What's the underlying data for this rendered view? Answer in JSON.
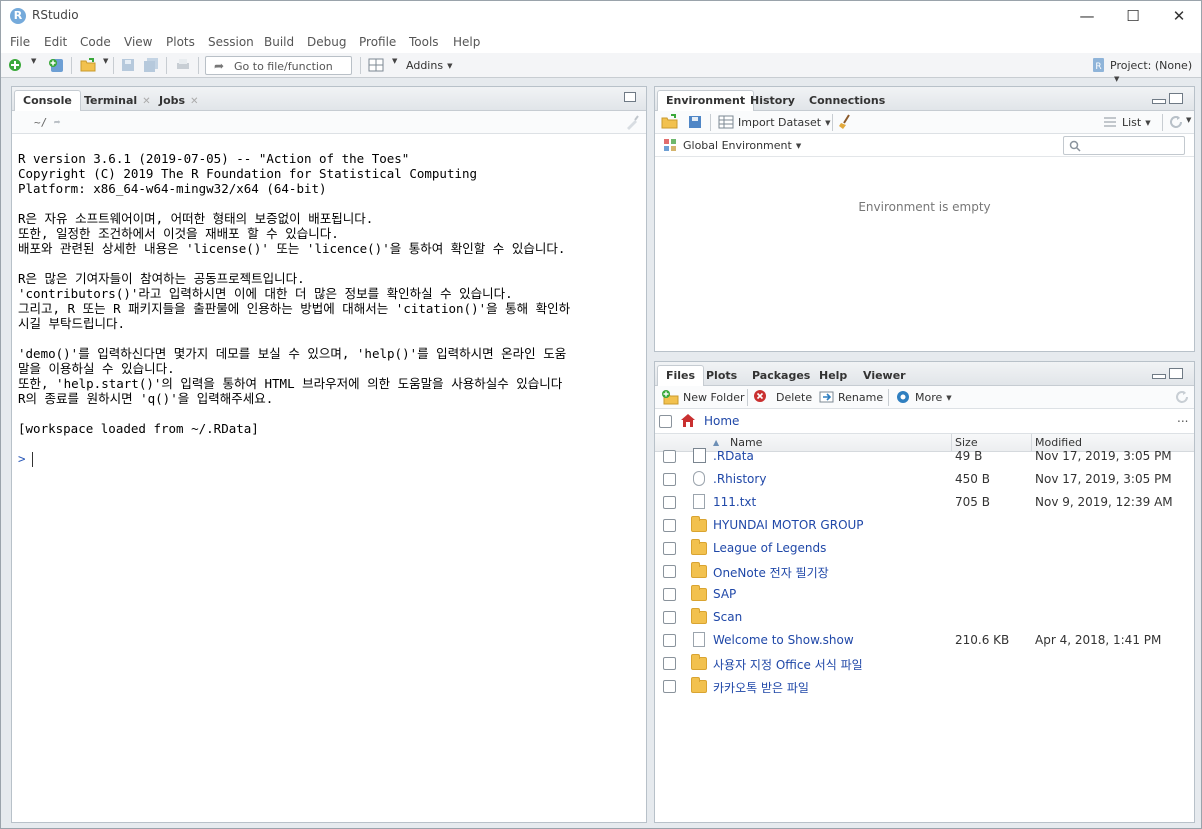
{
  "app": {
    "title": "RStudio",
    "icon_letter": "R"
  },
  "window_controls": {
    "minimize": "—",
    "maximize": "☐",
    "close": "✕"
  },
  "menubar": [
    "File",
    "Edit",
    "Code",
    "View",
    "Plots",
    "Session",
    "Build",
    "Debug",
    "Profile",
    "Tools",
    "Help"
  ],
  "toolbar": {
    "goto_placeholder": "Go to file/function",
    "addins_label": "Addins",
    "project_label": "Project: (None)"
  },
  "console_pane": {
    "tabs": [
      {
        "label": "Console",
        "active": true,
        "closable": false
      },
      {
        "label": "Terminal",
        "active": false,
        "closable": true
      },
      {
        "label": "Jobs",
        "active": false,
        "closable": true
      }
    ],
    "path": "~/",
    "lines": [
      "R version 3.6.1 (2019-07-05) -- \"Action of the Toes\"",
      "Copyright (C) 2019 The R Foundation for Statistical Computing",
      "Platform: x86_64-w64-mingw32/x64 (64-bit)",
      "",
      "R은 자유 소프트웨어이며, 어떠한 형태의 보증없이 배포됩니다.",
      "또한, 일정한 조건하에서 이것을 재배포 할 수 있습니다.",
      "배포와 관련된 상세한 내용은 'license()' 또는 'licence()'을 통하여 확인할 수 있습니다.",
      "",
      "R은 많은 기여자들이 참여하는 공동프로젝트입니다.",
      "'contributors()'라고 입력하시면 이에 대한 더 많은 정보를 확인하실 수 있습니다.",
      "그리고, R 또는 R 패키지들을 출판물에 인용하는 방법에 대해서는 'citation()'을 통해 확인하",
      "시길 부탁드립니다.",
      "",
      "'demo()'를 입력하신다면 몇가지 데모를 보실 수 있으며, 'help()'를 입력하시면 온라인 도움",
      "말을 이용하실 수 있습니다.",
      "또한, 'help.start()'의 입력을 통하여 HTML 브라우저에 의한 도움말을 사용하실수 있습니다",
      "R의 종료를 원하시면 'q()'을 입력해주세요.",
      "",
      "[workspace loaded from ~/.RData]",
      ""
    ],
    "prompt": ">"
  },
  "environment_pane": {
    "tabs": [
      {
        "label": "Environment",
        "active": true
      },
      {
        "label": "History",
        "active": false
      },
      {
        "label": "Connections",
        "active": false
      }
    ],
    "import_label": "Import Dataset",
    "view_mode": "List",
    "scope": "Global Environment",
    "empty_message": "Environment is empty"
  },
  "files_pane": {
    "tabs": [
      {
        "label": "Files",
        "active": true
      },
      {
        "label": "Plots",
        "active": false
      },
      {
        "label": "Packages",
        "active": false
      },
      {
        "label": "Help",
        "active": false
      },
      {
        "label": "Viewer",
        "active": false
      }
    ],
    "actions": {
      "new_folder": "New Folder",
      "delete": "Delete",
      "rename": "Rename",
      "more": "More"
    },
    "breadcrumb": "Home",
    "columns": {
      "name": "Name",
      "size": "Size",
      "modified": "Modified"
    },
    "rows": [
      {
        "name": ".RData",
        "size": "49 B",
        "modified": "Nov 17, 2019, 3:05 PM",
        "kind": "rdata"
      },
      {
        "name": ".Rhistory",
        "size": "450 B",
        "modified": "Nov 17, 2019, 3:05 PM",
        "kind": "rhistory"
      },
      {
        "name": "111.txt",
        "size": "705 B",
        "modified": "Nov 9, 2019, 12:39 AM",
        "kind": "doc"
      },
      {
        "name": "HYUNDAI MOTOR GROUP",
        "size": "",
        "modified": "",
        "kind": "folder"
      },
      {
        "name": "League of Legends",
        "size": "",
        "modified": "",
        "kind": "folder"
      },
      {
        "name": "OneNote 전자 필기장",
        "size": "",
        "modified": "",
        "kind": "folder"
      },
      {
        "name": "SAP",
        "size": "",
        "modified": "",
        "kind": "folder"
      },
      {
        "name": "Scan",
        "size": "",
        "modified": "",
        "kind": "folder"
      },
      {
        "name": "Welcome to Show.show",
        "size": "210.6 KB",
        "modified": "Apr 4, 2018, 1:41 PM",
        "kind": "doc"
      },
      {
        "name": "사용자 지정 Office 서식 파일",
        "size": "",
        "modified": "",
        "kind": "folder"
      },
      {
        "name": "카카오톡 받은 파일",
        "size": "",
        "modified": "",
        "kind": "folder"
      }
    ]
  }
}
